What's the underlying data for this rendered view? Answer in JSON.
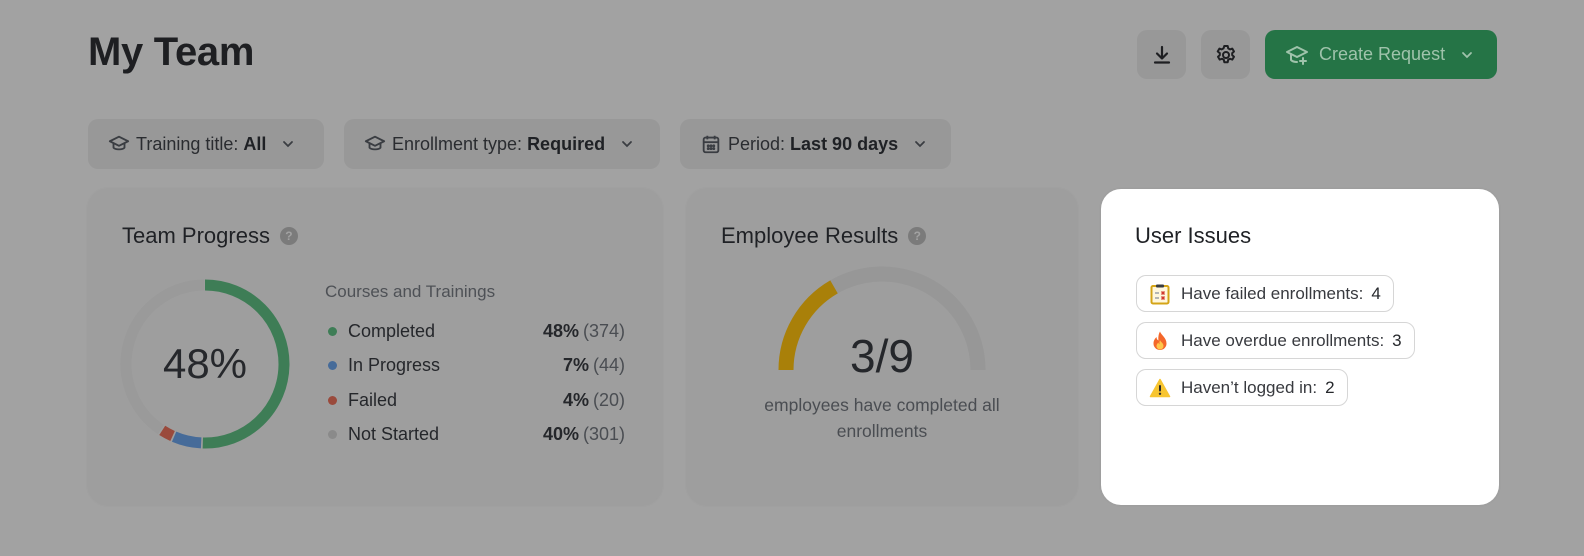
{
  "header": {
    "title": "My Team",
    "download_icon": "download-icon",
    "settings_icon": "gear-icon",
    "create_button": {
      "label": "Create Request",
      "icon": "graduation-cap-plus-icon",
      "color": "#257446"
    }
  },
  "filters": [
    {
      "label": "Training title:",
      "value": "All",
      "icon": "graduation-cap-icon"
    },
    {
      "label": "Enrollment type:",
      "value": "Required",
      "icon": "graduation-cap-icon"
    },
    {
      "label": "Period:",
      "value": "Last 90 days",
      "icon": "calendar-icon"
    }
  ],
  "team_progress": {
    "title": "Team Progress",
    "center_label": "48%",
    "legend_heading": "Courses and Trainings",
    "items": [
      {
        "label": "Completed",
        "pct": "48%",
        "count": "(374)",
        "value": 374,
        "color": "#3e7d56"
      },
      {
        "label": "In Progress",
        "pct": "7%",
        "count": "(44)",
        "value": 44,
        "color": "#466b99"
      },
      {
        "label": "Failed",
        "pct": "4%",
        "count": "(20)",
        "value": 20,
        "color": "#9a4a3c"
      },
      {
        "label": "Not Started",
        "pct": "40%",
        "count": "(301)",
        "value": 301,
        "color": "#8a8a8a"
      }
    ]
  },
  "employee_results": {
    "title": "Employee Results",
    "completed": 3,
    "total": 9,
    "value_label": "3/9",
    "caption": "employees have completed all enrollments",
    "fill_color": "#a98009",
    "track_color": "#979797"
  },
  "user_issues": {
    "title": "User Issues",
    "items": [
      {
        "label": "Have failed enrollments:",
        "count": "4",
        "icon": "clipboard-failed-icon"
      },
      {
        "label": "Have overdue enrollments:",
        "count": "3",
        "icon": "fire-icon"
      },
      {
        "label": "Haven’t logged in:",
        "count": "2",
        "icon": "warning-icon"
      }
    ]
  },
  "chart_data": [
    {
      "type": "pie",
      "title": "Team Progress",
      "categories": [
        "Completed",
        "In Progress",
        "Failed",
        "Not Started"
      ],
      "values": [
        374,
        44,
        20,
        301
      ],
      "percentages": [
        48,
        7,
        4,
        40
      ],
      "center_label": "48%"
    },
    {
      "type": "gauge",
      "title": "Employee Results",
      "value": 3,
      "max": 9,
      "label": "3/9"
    }
  ]
}
